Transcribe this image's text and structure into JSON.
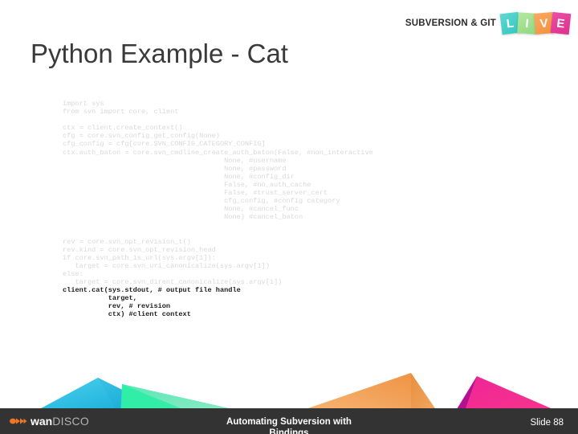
{
  "header": {
    "brand_text": "SUBVERSION & GIT",
    "logo_letters": [
      "L",
      "I",
      "V",
      "E"
    ],
    "logo_colors": [
      "#35c6c0",
      "#8fd880",
      "#f3913f",
      "#dd2f8f"
    ]
  },
  "title": "Python Example - Cat",
  "code": {
    "lines": [
      {
        "text": "import sys",
        "style": "faint"
      },
      {
        "text": "from svn import core, client",
        "style": "faint"
      },
      {
        "text": "",
        "style": "blank"
      },
      {
        "text": "ctx = client.create_context()",
        "style": "faint"
      },
      {
        "text": "cfg = core.svn_config_get_config(None)",
        "style": "faint"
      },
      {
        "text": "cfg_config = cfg[core.SVN_CONFIG_CATEGORY_CONFIG]",
        "style": "faint"
      },
      {
        "text": "ctx.auth_baton = core.svn_cmdline_create_auth_baton(False, #non_interactive",
        "style": "faint"
      },
      {
        "text": "                                       None, #username",
        "style": "faint"
      },
      {
        "text": "                                       None, #password",
        "style": "faint"
      },
      {
        "text": "                                       None, #config_dir",
        "style": "faint"
      },
      {
        "text": "                                       False, #no_auth_cache",
        "style": "faint"
      },
      {
        "text": "                                       False, #trust_server_cert",
        "style": "faint"
      },
      {
        "text": "                                       cfg_config, #config category",
        "style": "faint"
      },
      {
        "text": "                                       None, #cancel_func",
        "style": "faint"
      },
      {
        "text": "                                       None) #cancel_baton",
        "style": "faint"
      },
      {
        "text": "",
        "style": "blank"
      },
      {
        "text": "",
        "style": "blank"
      },
      {
        "text": "rev = core.svn_opt_revision_t()",
        "style": "faint"
      },
      {
        "text": "rev.kind = core.svn_opt_revision_head",
        "style": "faint"
      },
      {
        "text": "if core.svn_path_is_url(sys.argv[1]):",
        "style": "faint"
      },
      {
        "text": "   target = core.svn_uri_canonicalize(sys.argv[1])",
        "style": "faint"
      },
      {
        "text": "else:",
        "style": "faint"
      },
      {
        "text": "   target = core.svn_dirent_canonicalize(sys.argv[1])",
        "style": "faint"
      },
      {
        "text": "client.cat(sys.stdout, # output file handle",
        "style": "bold"
      },
      {
        "text": "           target,",
        "style": "bold"
      },
      {
        "text": "           rev, # revision",
        "style": "bold"
      },
      {
        "text": "           ctx) #client context",
        "style": "bold"
      }
    ]
  },
  "shapes": [
    {
      "name": "cyan-peak",
      "color_light": "#29bfe0",
      "color_dark": "#0c9fcb"
    },
    {
      "name": "green-peak",
      "color_light": "#2ef0a6",
      "color_dark": "#7fe0b4"
    },
    {
      "name": "orange-peak",
      "color_light": "#f5a657",
      "color_dark": "#e8913f"
    },
    {
      "name": "magenta-peak",
      "color_light": "#f72f8f",
      "color_dark": "#b8128c"
    }
  ],
  "footer": {
    "logo_wan": "wan",
    "logo_disco": "DISCO",
    "center_line1": "Automating Subversion with",
    "center_line2": "Bindings",
    "slide_number": "Slide 88",
    "bar_color": "#333333"
  }
}
